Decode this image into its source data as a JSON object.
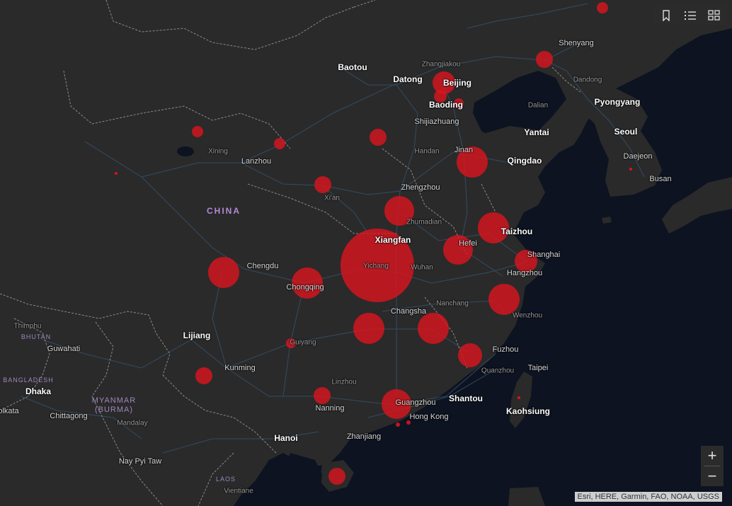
{
  "toolbar": {
    "icons": [
      "bookmark-icon",
      "legend-icon",
      "basemap-gallery-icon"
    ]
  },
  "zoom": {
    "in_label": "+",
    "out_label": "−"
  },
  "attribution": "Esri, HERE, Garmin, FAO, NOAA, USGS",
  "country_labels": {
    "china": "CHINA",
    "myanmar": "MYANMAR",
    "burma": "(BURMA)",
    "laos": "LAOS",
    "bhutan": "BHUTAN",
    "bangladesh": "BANGLADESH"
  },
  "city_labels": {
    "baotou": "Baotou",
    "zhangjiakou": "Zhangjiakou",
    "beijing": "Beijing",
    "datong": "Datong",
    "baoding": "Baoding",
    "shijiazhuang": "Shijiazhuang",
    "jinan": "Jinan",
    "handan": "Handan",
    "yantai": "Yantai",
    "qingdao": "Qingdao",
    "shenyang": "Shenyang",
    "dandong": "Dandong",
    "dalian": "Dalian",
    "pyongyang": "Pyongyang",
    "seoul": "Seoul",
    "daejeon": "Daejeon",
    "busan": "Busan",
    "xining": "Xining",
    "lanzhou": "Lanzhou",
    "xian": "Xi'an",
    "zhengzhou": "Zhengzhou",
    "zhumadian": "Zhumadian",
    "xiangfan": "Xiangfan",
    "yichang": "Yichang",
    "wuhan": "Wuhan",
    "hefei": "Hefei",
    "taizhou": "Taizhou",
    "shanghai": "Shanghai",
    "hangzhou": "Hangzhou",
    "chengdu": "Chengdu",
    "chongqing": "Chongqing",
    "changsha": "Changsha",
    "nanchang": "Nanchang",
    "wenzhou": "Wenzhou",
    "fuzhou": "Fuzhou",
    "quanzhou": "Quanzhou",
    "taipei": "Taipei",
    "kaohsiung": "Kaohsiung",
    "shantou": "Shantou",
    "guangzhou": "Guangzhou",
    "hongkong": "Hong Kong",
    "zhanjiang": "Zhanjiang",
    "nanning": "Nanning",
    "linzhou": "Linzhou",
    "guiyang": "Guiyang",
    "kunming": "Kunming",
    "lijiang": "Lijiang",
    "thimphu": "Thimphu",
    "guwahati": "Guwahati",
    "dhaka": "Dhaka",
    "kolkata": "olkata",
    "chittagong": "Chittagong",
    "mandalay": "Mandalay",
    "naypyitaw": "Nay Pyi Taw",
    "hanoi": "Hanoi",
    "vientiane": "Vientiane"
  },
  "case_markers": [
    {
      "place": "Hubei (Xiangfan / Yichang / Wuhan area)",
      "size": 52
    },
    {
      "place": "Beijing",
      "size": 16
    },
    {
      "place": "Jinan",
      "size": 22
    },
    {
      "place": "Henan",
      "size": 21
    },
    {
      "place": "Taizhou",
      "size": 22
    },
    {
      "place": "Hefei",
      "size": 21
    },
    {
      "place": "Shanghai",
      "size": 16
    },
    {
      "place": "Hangzhou / Zhejiang",
      "size": 22
    },
    {
      "place": "Chengdu",
      "size": 22
    },
    {
      "place": "Chongqing",
      "size": 22
    },
    {
      "place": "Changsha / Hunan",
      "size": 22
    },
    {
      "place": "Nanchang / Jiangxi",
      "size": 22
    },
    {
      "place": "Fuzhou / Fujian",
      "size": 17
    },
    {
      "place": "Guangzhou / Guangdong",
      "size": 21
    },
    {
      "place": "Xi'an",
      "size": 12
    },
    {
      "place": "Datong area",
      "size": 12
    },
    {
      "place": "Shenyang",
      "size": 12
    },
    {
      "place": "Xining area",
      "size": 8
    },
    {
      "place": "Ningxia",
      "size": 8
    },
    {
      "place": "Kunming",
      "size": 12
    },
    {
      "place": "Nanning",
      "size": 12
    },
    {
      "place": "Hainan",
      "size": 12
    },
    {
      "place": "Harbin area",
      "size": 8
    },
    {
      "place": "Guiyang",
      "size": 7
    },
    {
      "place": "Baoding",
      "size": 7
    },
    {
      "place": "Hong Kong",
      "size": 3
    },
    {
      "place": "Tibet",
      "size": 2
    },
    {
      "place": "Taiwan",
      "size": 2
    },
    {
      "place": "Korea",
      "size": 2
    },
    {
      "place": "Macau",
      "size": 3
    }
  ],
  "colors": {
    "land": "#2a2a2a",
    "water": "#0d1320",
    "roads": "#35506b",
    "borders": "#7a7a7a",
    "marker_fill": "#dc141e"
  }
}
